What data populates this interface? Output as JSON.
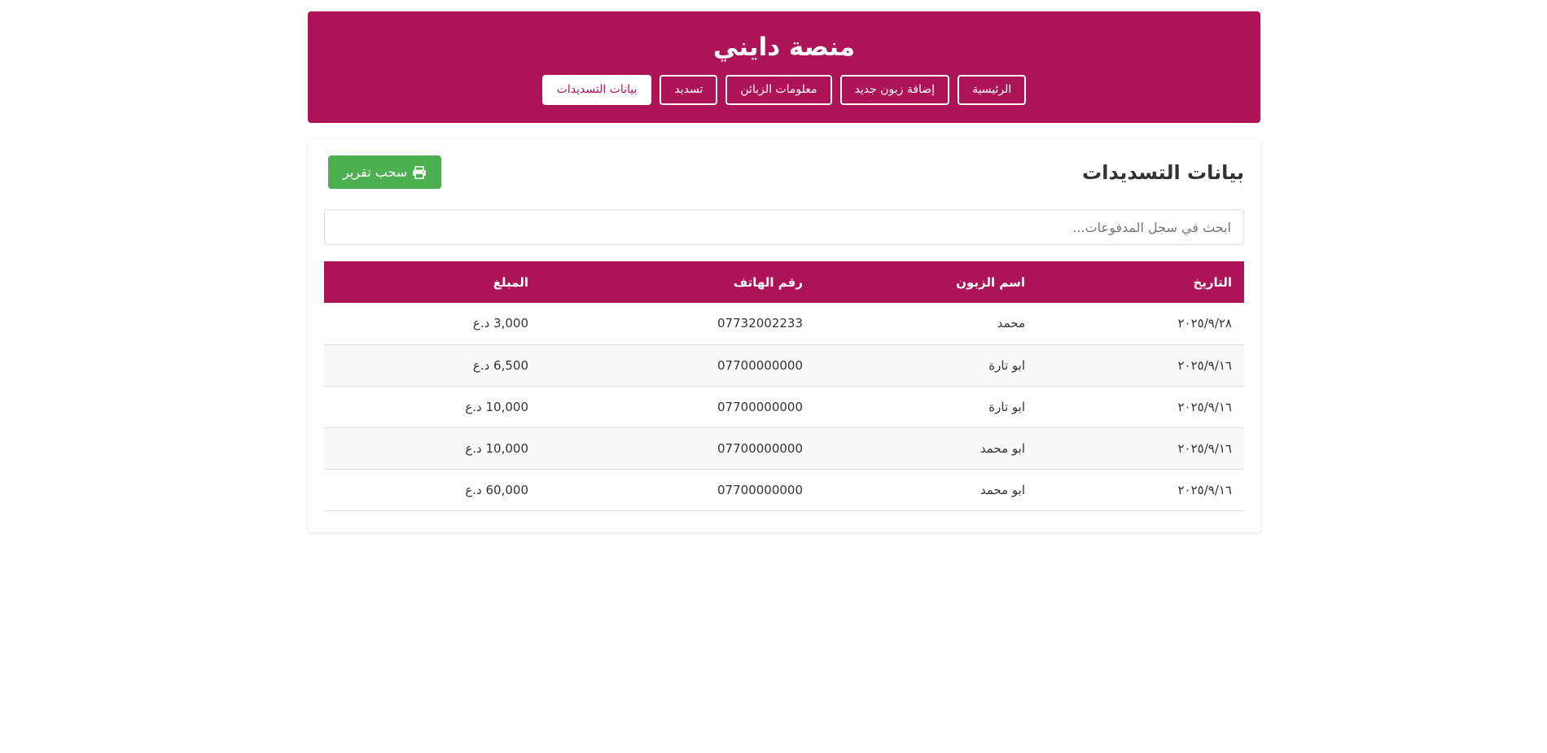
{
  "header": {
    "title": "منصة دايني",
    "nav": [
      {
        "label": "الرئيسية",
        "active": false
      },
      {
        "label": "إضافة زبون جديد",
        "active": false
      },
      {
        "label": "معلومات الزبائن",
        "active": false
      },
      {
        "label": "تسديد",
        "active": false
      },
      {
        "label": "بيانات التسديدات",
        "active": true
      }
    ]
  },
  "main": {
    "title": "بيانات التسديدات",
    "report_button": {
      "label": "سحب تقرير",
      "icon": "printer-icon"
    },
    "search": {
      "placeholder": "ابحث في سجل المدفوعات...",
      "value": ""
    },
    "table": {
      "columns": [
        "التاريخ",
        "اسم الزبون",
        "رقم الهاتف",
        "المبلغ"
      ],
      "rows": [
        {
          "date": "٢٠٢٥/٩/٢٨",
          "name": "محمد",
          "phone": "07732002233",
          "amount": "3,000 د.ع"
        },
        {
          "date": "٢٠٢٥/٩/١٦",
          "name": "ابو تارة",
          "phone": "07700000000",
          "amount": "6,500 د.ع"
        },
        {
          "date": "٢٠٢٥/٩/١٦",
          "name": "ابو تارة",
          "phone": "07700000000",
          "amount": "10,000 د.ع"
        },
        {
          "date": "٢٠٢٥/٩/١٦",
          "name": "ابو محمد",
          "phone": "07700000000",
          "amount": "10,000 د.ع"
        },
        {
          "date": "٢٠٢٥/٩/١٦",
          "name": "ابو محمد",
          "phone": "07700000000",
          "amount": "60,000 د.ع"
        }
      ]
    }
  },
  "colors": {
    "brand": "#ad1457",
    "report_button": "#4caf50",
    "row_alt": "#f9f9f9"
  }
}
